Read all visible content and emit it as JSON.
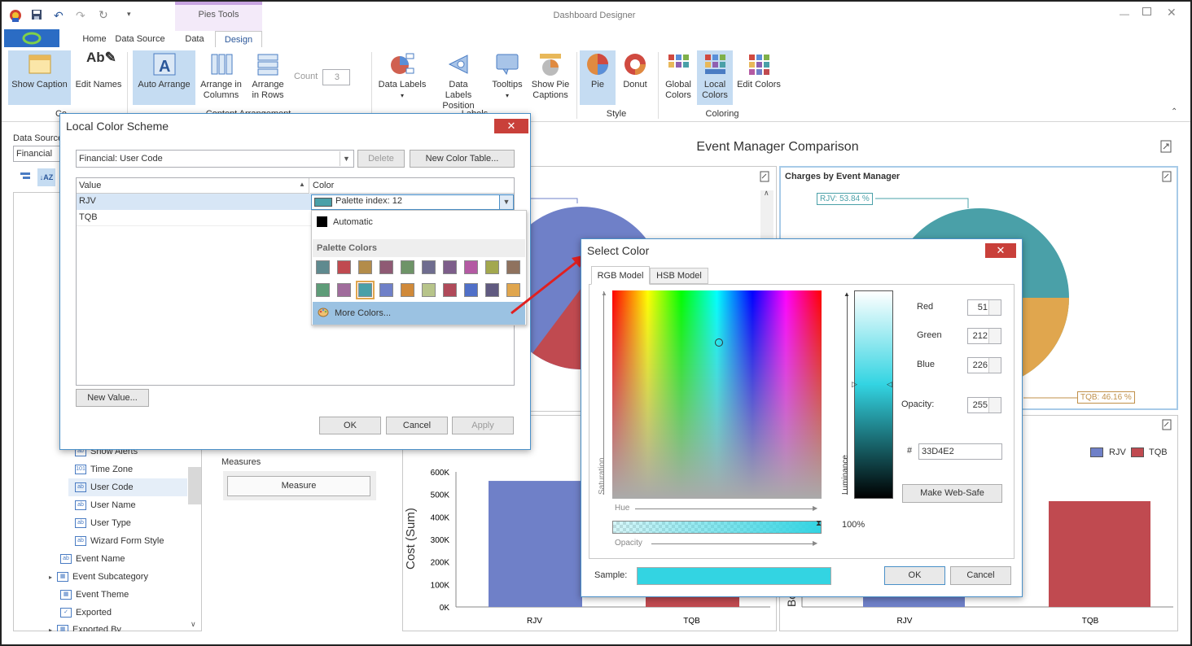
{
  "app": {
    "title": "Dashboard Designer",
    "context_tab": "Pies Tools"
  },
  "tabs": [
    "Home",
    "Data Source",
    "Data",
    "Design"
  ],
  "ribbon": {
    "show_caption": "Show Caption",
    "edit_names": "Edit Names",
    "auto_arrange": "Auto Arrange",
    "arrange_columns": "Arrange in Columns",
    "arrange_rows": "Arrange in Rows",
    "count_label": "Count",
    "count_value": "3",
    "data_labels": "Data Labels",
    "data_labels_position": "Data Labels Position",
    "tooltips": "Tooltips",
    "show_pie_captions": "Show Pie Captions",
    "pie": "Pie",
    "donut": "Donut",
    "global_colors": "Global Colors",
    "local_colors": "Local Colors",
    "edit_colors": "Edit Colors",
    "group_style": "Style",
    "group_coloring": "Coloring",
    "group_common": "Co",
    "group_content_arrangement": "Content Arrangement",
    "group_labels": "Labels"
  },
  "sidebar": {
    "data_source_label": "Data Source",
    "data_source_value": "Financial",
    "items": [
      "Show Alerts",
      "Time Zone",
      "User Code",
      "User Name",
      "User Type",
      "Wizard Form Style",
      "Event Name",
      "Event Subcategory",
      "Event Theme",
      "Exported",
      "Exported By"
    ]
  },
  "measures": {
    "label": "Measures",
    "button": "Measure"
  },
  "dashboard": {
    "title": "Event Manager Comparison",
    "panel_charges": "Charges by Event Manager"
  },
  "chart_data": [
    {
      "type": "pie",
      "title": "Charges by Event Manager",
      "categories": [
        "RJV",
        "TQB"
      ],
      "values": [
        53.84,
        46.16
      ],
      "labels": [
        "RJV: 53.84 %",
        "TQB: 46.16 %"
      ],
      "colors": [
        "#4aa0a8",
        "#e0a64e"
      ]
    },
    {
      "type": "bar",
      "categories": [
        "RJV",
        "TQB"
      ],
      "ylabel": "Cost (Sum)",
      "yticks": [
        "0K",
        "100K",
        "200K",
        "300K",
        "400K",
        "500K",
        "600K"
      ],
      "ylim": [
        0,
        600000
      ],
      "values": [
        560000,
        120000
      ],
      "colors": [
        "#6f80c8",
        "#c04a50"
      ],
      "legend": [
        "RJV",
        "TQB"
      ]
    },
    {
      "type": "bar",
      "categories": [
        "RJV",
        "TQB"
      ],
      "legend": [
        "RJV",
        "TQB"
      ],
      "ylabel": "Bo",
      "values": [
        null,
        470000
      ],
      "colors": [
        "#6f80c8",
        "#c04a50"
      ]
    }
  ],
  "local_scheme": {
    "title": "Local Color Scheme",
    "scheme_value": "Financial: User Code",
    "delete": "Delete",
    "new_table": "New Color Table...",
    "col_value": "Value",
    "col_color": "Color",
    "rows": [
      {
        "value": "RJV",
        "color": "Palette index: 12"
      },
      {
        "value": "TQB",
        "color": ""
      }
    ],
    "new_value": "New Value...",
    "ok": "OK",
    "cancel": "Cancel",
    "apply": "Apply",
    "dropdown": {
      "automatic": "Automatic",
      "palette_header": "Palette Colors",
      "more": "More Colors...",
      "palette": [
        "#5f8a8f",
        "#c04a50",
        "#b38c4a",
        "#8f5a74",
        "#6e9468",
        "#6f6d8f",
        "#7d5e8a",
        "#b45aa3",
        "#a3a84e",
        "#8f725e",
        "#5e9c78",
        "#a06c9c",
        "#4aa0a8",
        "#6f80c8",
        "#d08a3a",
        "#b7c48a",
        "#b04a5a",
        "#5070c8",
        "#605a80",
        "#e0a64e"
      ]
    }
  },
  "select_color": {
    "title": "Select Color",
    "tab_rgb": "RGB Model",
    "tab_hsb": "HSB Model",
    "saturation": "Saturation",
    "hue": "Hue",
    "opacity_axis": "Opacity",
    "luminance": "Luminance",
    "red_label": "Red",
    "red": "51",
    "green_label": "Green",
    "green": "212",
    "blue_label": "Blue",
    "blue": "226",
    "opacity_label": "Opacity:",
    "opacity": "255",
    "hash": "#",
    "hex": "33D4E2",
    "web_safe": "Make Web-Safe",
    "opacity_pct": "100%",
    "sample": "Sample:",
    "ok": "OK",
    "cancel": "Cancel",
    "sample_color": "#33d4e2"
  }
}
